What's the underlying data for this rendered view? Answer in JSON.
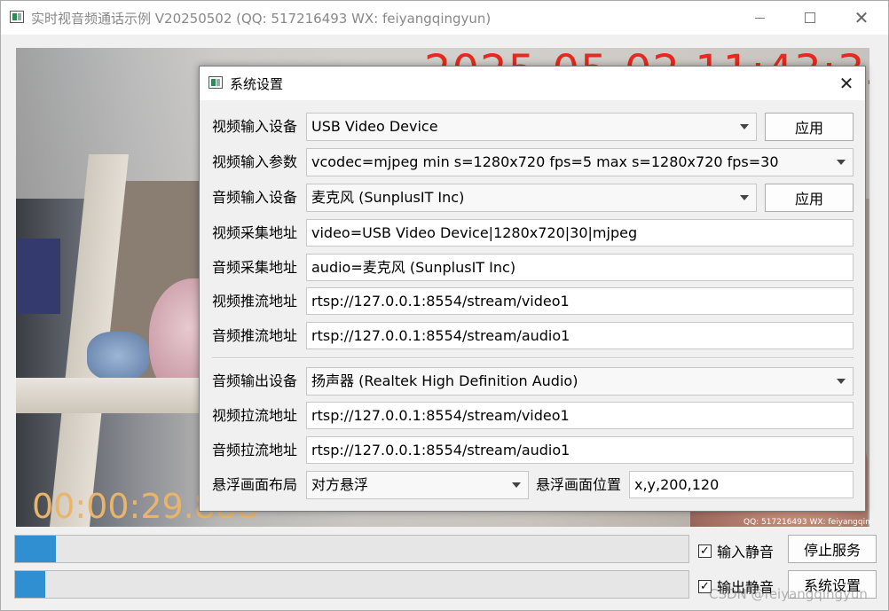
{
  "main_window": {
    "title": "实时视音频通话示例 V20250502 (QQ: 517216493 WX: feiyangqingyun)",
    "controls": {
      "minimize": "minimize-icon",
      "maximize": "maximize-icon",
      "close": "close-icon"
    }
  },
  "video": {
    "datetime_overlay": "2025-05-02 11:43:33",
    "elapsed_overlay": "00:00:29.888",
    "watermark": "QQ: 517216493  WX: feiyangqingyun"
  },
  "bottom": {
    "input_level": 0.06,
    "output_level": 0.045,
    "input_mute_label": "输入静音",
    "input_mute_checked": true,
    "output_mute_label": "输出静音",
    "output_mute_checked": true,
    "stop_service_label": "停止服务",
    "system_settings_label": "系统设置",
    "csdn_watermark": "CSDN @feiyangqingyun"
  },
  "dialog": {
    "title": "系统设置",
    "apply_label": "应用",
    "rows": {
      "video_input_device": {
        "label": "视频输入设备",
        "value": "USB Video Device"
      },
      "video_input_params": {
        "label": "视频输入参数",
        "value": "vcodec=mjpeg min s=1280x720 fps=5 max s=1280x720 fps=30"
      },
      "audio_input_device": {
        "label": "音频输入设备",
        "value": "麦克风 (SunplusIT Inc)"
      },
      "video_capture_url": {
        "label": "视频采集地址",
        "value": "video=USB Video Device|1280x720|30|mjpeg"
      },
      "audio_capture_url": {
        "label": "音频采集地址",
        "value": "audio=麦克风 (SunplusIT Inc)"
      },
      "video_push_url": {
        "label": "视频推流地址",
        "value": "rtsp://127.0.0.1:8554/stream/video1"
      },
      "audio_push_url": {
        "label": "音频推流地址",
        "value": "rtsp://127.0.0.1:8554/stream/audio1"
      },
      "audio_output_device": {
        "label": "音频输出设备",
        "value": "扬声器 (Realtek High Definition Audio)"
      },
      "video_pull_url": {
        "label": "视频拉流地址",
        "value": "rtsp://127.0.0.1:8554/stream/video1"
      },
      "audio_pull_url": {
        "label": "音频拉流地址",
        "value": "rtsp://127.0.0.1:8554/stream/audio1"
      },
      "float_layout": {
        "label": "悬浮画面布局",
        "value": "对方悬浮"
      },
      "float_position": {
        "label": "悬浮画面位置",
        "value": "x,y,200,120"
      }
    }
  },
  "colors": {
    "accent_bar": "#2f8fd1",
    "osd_datetime": "#e52a1f",
    "osd_elapsed": "#e8b56a"
  }
}
